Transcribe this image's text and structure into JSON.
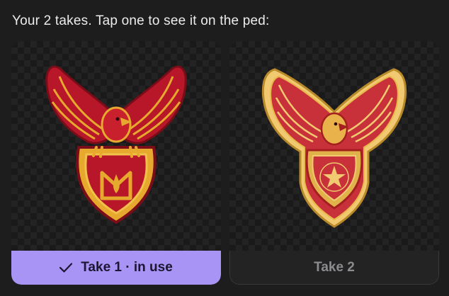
{
  "heading": "Your 2 takes. Tap one to see it on the ped:",
  "takes": [
    {
      "label": "Take 1 · in use",
      "selected": true,
      "icon": "checkmark-icon",
      "preview": "red-eagle-shield-patch-with-flame"
    },
    {
      "label": "Take 2",
      "selected": false,
      "preview": "gold-eagle-shield-patch-with-star"
    }
  ],
  "colors": {
    "background": "#1d1d1e",
    "accent": "#a894f4",
    "accent_text": "#1b1633",
    "inactive_text": "#8c8c90",
    "patch_red": "#b8172a",
    "patch_gold": "#e6a92e"
  }
}
